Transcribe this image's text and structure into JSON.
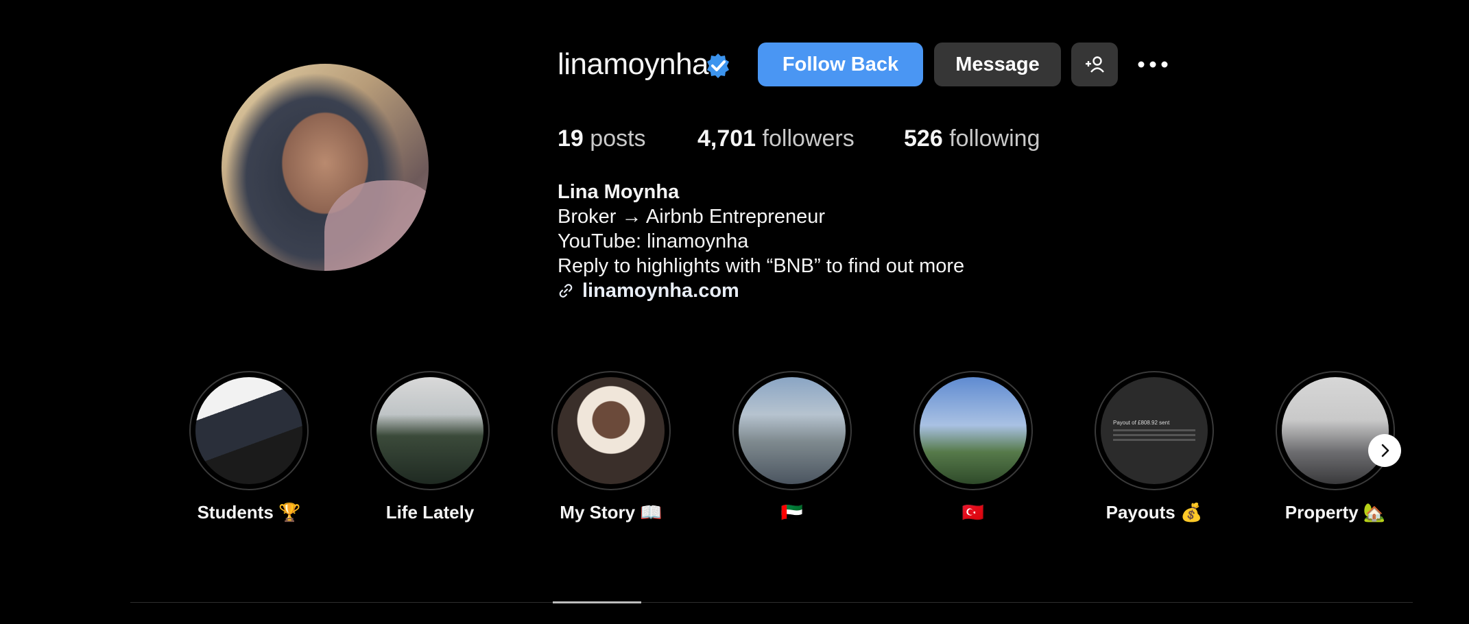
{
  "profile": {
    "username": "linamoynha",
    "verified": true,
    "buttons": {
      "follow_back": "Follow Back",
      "message": "Message"
    },
    "stats": {
      "posts_count": "19",
      "posts_label": "posts",
      "followers_count": "4,701",
      "followers_label": "followers",
      "following_count": "526",
      "following_label": "following"
    },
    "bio": {
      "name": "Lina Moynha",
      "line1": "Broker → Airbnb Entrepreneur",
      "line2": "YouTube: linamoynha",
      "line3": "Reply to highlights with “BNB” to find out more",
      "link": "linamoynha.com"
    }
  },
  "highlights": [
    {
      "label": "Students 🏆"
    },
    {
      "label": "Life Lately"
    },
    {
      "label": "My Story 📖"
    },
    {
      "label": "🇦🇪"
    },
    {
      "label": "🇹🇷"
    },
    {
      "label": "Payouts 💰",
      "thumb_text": "Payout of £808.92 sent"
    },
    {
      "label": "Property 🏡"
    }
  ],
  "colors": {
    "accent": "#4a96f3",
    "button_secondary": "#363636",
    "background": "#000000"
  },
  "icons": {
    "verified": "verified-badge-icon",
    "add_user": "add-user-icon",
    "more": "more-options-icon",
    "link": "link-icon",
    "next": "chevron-right-icon"
  }
}
